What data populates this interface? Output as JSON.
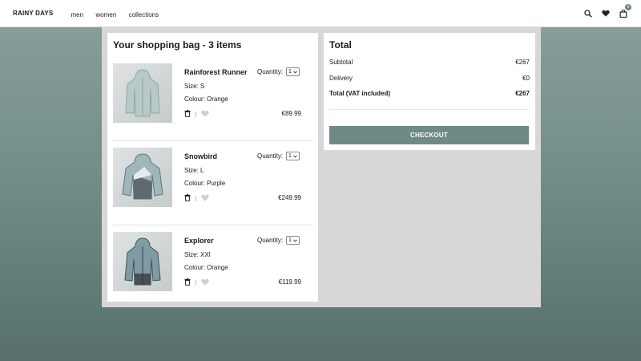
{
  "header": {
    "logo": "RAINY DAYS",
    "nav": [
      "men",
      "women",
      "collections"
    ],
    "cart_count": "3"
  },
  "bag": {
    "title": "Your shopping bag - 3 items",
    "quantity_label": "Quantity:",
    "items": [
      {
        "name": "Rainforest Runner",
        "size": "Size: S",
        "colour": "Colour: Orange",
        "qty": "1",
        "price": "€89.99"
      },
      {
        "name": "Snowbird",
        "size": "Size: L",
        "colour": "Colour: Purple",
        "qty": "1",
        "price": "€249.99"
      },
      {
        "name": "Explorer",
        "size": "Size: XXl",
        "colour": "Colour: Orange",
        "qty": "1",
        "price": "€119.99"
      }
    ]
  },
  "total": {
    "title": "Total",
    "subtotal_label": "Subtotal",
    "subtotal_value": "€267",
    "delivery_label": "Delivery",
    "delivery_value": "€0",
    "total_label": "Total (VAT included)",
    "total_value": "€267",
    "checkout_label": "CHECKOUT"
  },
  "colors": {
    "accent": "#6f8a86",
    "panel_bg": "#d7d7d7"
  },
  "icons": [
    "search-icon",
    "heart-icon",
    "bag-icon",
    "trash-icon",
    "heart-outline-icon",
    "chevron-down-icon"
  ]
}
